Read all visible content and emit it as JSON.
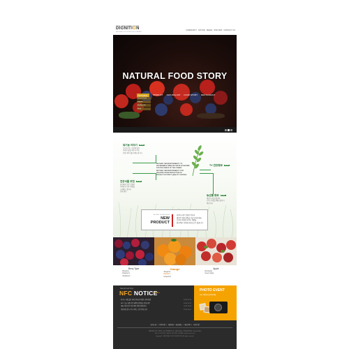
{
  "header": {
    "logo_small": "THE ORGANIC FOOD",
    "logo_prefix": "DIGNITI",
    "logo_o": "O",
    "logo_suffix": "N",
    "logo_sub": "NATURAL FOOD DIGNITION COMPANY",
    "nav": [
      "COMMUNITY",
      "NOTICE",
      "MEDIA",
      "SITE MAP",
      "CONTACT US"
    ]
  },
  "hero": {
    "title": "NATURAL FOOD STORY",
    "nav": [
      "NATURAL",
      "PRODUCT",
      "NATURAL FAT",
      "FOOD STORY",
      "RESTAURANT"
    ],
    "dropdown": [
      "Natural Food",
      "Organic",
      "Healthy Life",
      "Story"
    ],
    "slides": 3,
    "active_slide": 2
  },
  "story": {
    "left_top": {
      "title": "유기농 이야기",
      "badge": "MORE",
      "lines": [
        "우리가 먹는 자연의 맛과",
        "건강한 삶을 위한 유기농",
        "식품 이야기를 전해드립니다"
      ]
    },
    "left_bottom": {
      "title": "건강식품 추천",
      "badge": "MORE",
      "lines": [
        "자연에서 얻은 건강한",
        "식재료로 만든 제품을",
        "소개해 드립니다",
        "건강 정보"
      ]
    },
    "right_top": {
      "title": "TV 건강정보",
      "badge": "MORE"
    },
    "right_bottom": {
      "title": "농산물 정보",
      "badge": "MORE",
      "lines": [
        "제철 농산물 정보와",
        "농가 소식을 전해드립니다",
        "바로가기"
      ]
    },
    "center": [
      "WE TAKE THE RESPONSIBILITY TO",
      "SUSTAINABLE TABLE AS TASTE OF NATURE",
      "FOR THE GRACE OF THE COMING",
      "WE TAKE THE RESPONSIBILITY FOR",
      "DELIVERY FROM PRODUCTION OF",
      "PRODUCT IN STRICT QUALITY CONTROL"
    ]
  },
  "new_product": {
    "small": "We Offer You Best Food",
    "title": "NEW PRODUCT",
    "lines": [
      "자연이 키운 건강한 먹거리",
      "새로운 제철 상품을 지금 만나보세요",
      "신선한 과일과 유기농 제품을",
      "합리적인 가격에 만나보실 수 있습니다"
    ]
  },
  "products": [
    {
      "name": "Berry Type",
      "items": [
        "Blueberry",
        "Raspberry",
        "Strawberry"
      ]
    },
    {
      "name": "Orange",
      "items": [
        "Tangerine",
        "Mandarin",
        "Grapefruit"
      ]
    },
    {
      "name": "Apple",
      "items": [
        "Red Apple",
        "Green Apple"
      ]
    }
  ],
  "notice": {
    "small": "Natural food Story",
    "title_main": "NFC ",
    "title_rest": "NOTICE",
    "more": "MORE +",
    "items": [
      {
        "text": "유기농 식품 할인 행사 안내 및 이벤트 참여 방법",
        "date": "2014.12.15"
      },
      {
        "text": "NFC 신규 회원 가입 혜택 및 적립금 안내 사항",
        "date": "2014.12.10"
      },
      {
        "text": "제철 과일 산지 직송 배송 일정 변경 안내",
        "date": "2014.12.08"
      },
      {
        "text": "건강식품 정기 구독 서비스 오픈 안내 공지",
        "date": "2014.12.01"
      }
    ]
  },
  "photo_event": {
    "title": "PHOTO EVENT",
    "sub": "포토 이벤트에 참여하세요"
  },
  "footer": {
    "nav": "회사소개 | 이용약관 | 개인정보 취급방침 | 제휴문의 | 사이트맵",
    "info": [
      "서울특별시 중구 자연로 123 내추럴빌딩 5층 | 대표 홍길동 | 사업자등록번호 123-45-67890",
      "TEL 02-123-4567 | FAX 02-123-4568 | E-MAIL info@natural.co.kr",
      "Copyright © NATURAL FOOD DIGNITION. All rights reserved."
    ]
  },
  "colors": {
    "accent_green": "#2f8a3a",
    "accent_orange": "#e57f0a",
    "hero_nav_active": "#d7a31a",
    "notice_bg": "#2a2a2a",
    "photo_bg": "#f5a300",
    "footer_bg": "#2b2b2b"
  }
}
